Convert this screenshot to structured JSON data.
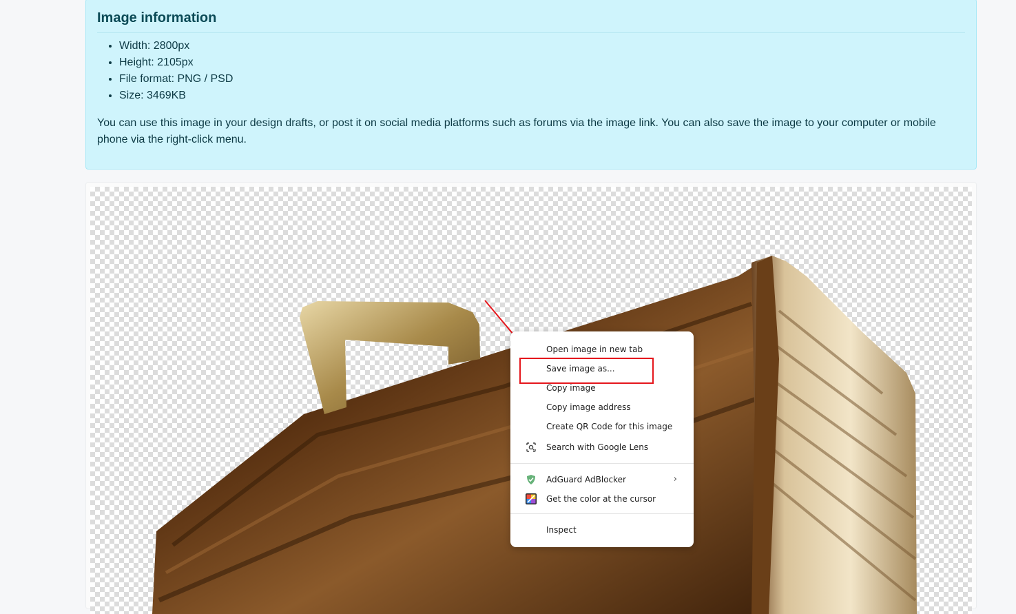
{
  "info": {
    "title": "Image information",
    "details": [
      "Width: 2800px",
      "Height: 2105px",
      "File format: PNG / PSD",
      "Size: 3469KB"
    ],
    "description": "You can use this image in your design drafts, or post it on social media platforms such as forums via the image link. You can also save the image to your computer or mobile phone via the right-click menu."
  },
  "context_menu": {
    "items": [
      {
        "label": "Open image in new tab"
      },
      {
        "label": "Save image as..."
      },
      {
        "label": "Copy image"
      },
      {
        "label": "Copy image address"
      },
      {
        "label": "Create QR Code for this image"
      },
      {
        "label": "Search with Google Lens",
        "icon": "google-lens-icon"
      },
      {
        "label": "AdGuard AdBlocker",
        "icon": "adguard-shield-icon",
        "submenu": true
      },
      {
        "label": "Get the color at the cursor",
        "icon": "color-picker-icon"
      },
      {
        "label": "Inspect"
      }
    ],
    "highlighted_item": "Save image as...",
    "highlight_color": "#e5161c"
  },
  "colors": {
    "info_bg": "#cff4fc",
    "info_text": "#0b4a56",
    "annotation_red": "#e5161c"
  }
}
